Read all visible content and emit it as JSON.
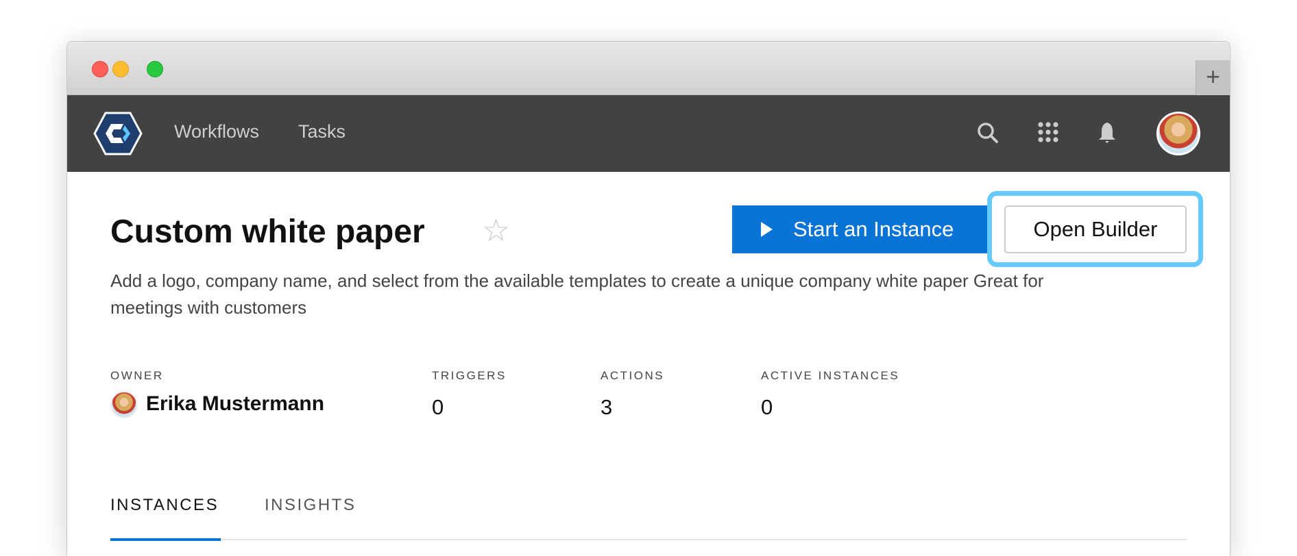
{
  "window": {
    "new_tab_label": "+"
  },
  "nav": {
    "links": [
      "Workflows",
      "Tasks"
    ],
    "icons": [
      "search-icon",
      "apps-grid-icon",
      "bell-icon"
    ]
  },
  "page": {
    "title": "Custom white paper",
    "star": "☆",
    "start_button": "Start an Instance",
    "open_builder_button": "Open Builder",
    "description": "Add a logo, company name, and select from the available templates to create a unique company white paper Great for meetings with customers"
  },
  "stats": [
    {
      "label": "OWNER",
      "value": "Erika Mustermann"
    },
    {
      "label": "TRIGGERS",
      "value": "0"
    },
    {
      "label": "ACTIONS",
      "value": "3"
    },
    {
      "label": "ACTIVE INSTANCES",
      "value": "0"
    }
  ],
  "tabs": [
    {
      "label": "INSTANCES",
      "active": true
    },
    {
      "label": "INSIGHTS",
      "active": false
    }
  ],
  "colors": {
    "accent": "#0a74d6",
    "highlight": "#66caff",
    "navbar": "#424242"
  }
}
